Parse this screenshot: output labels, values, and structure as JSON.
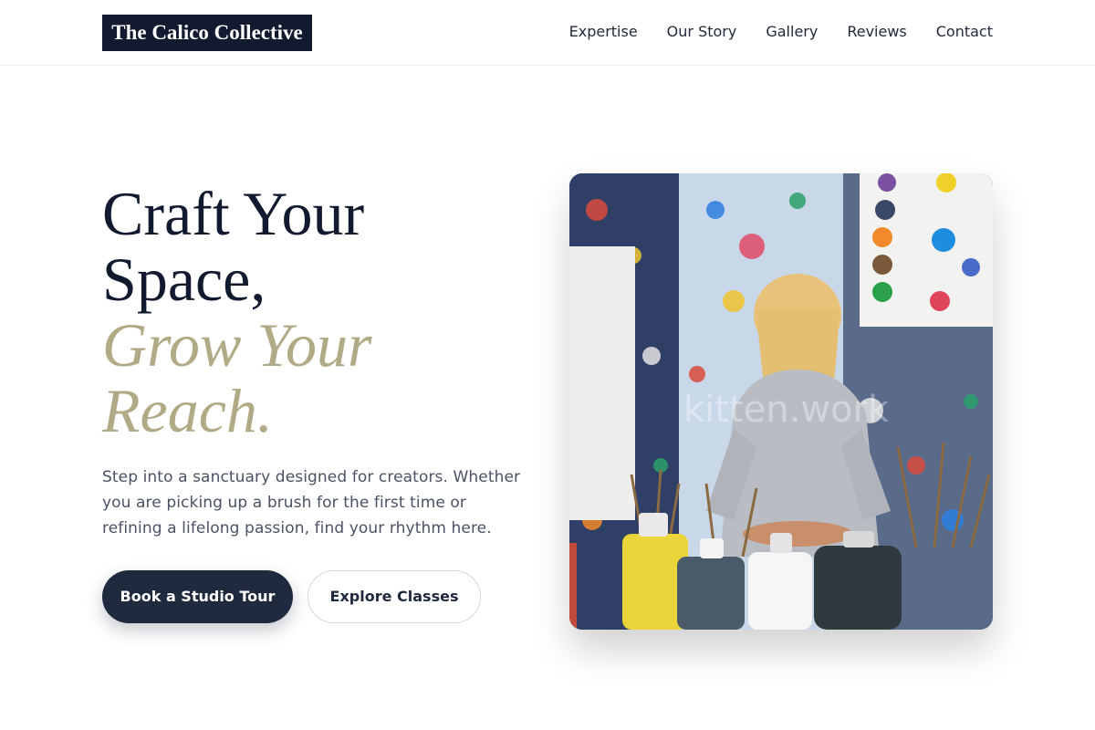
{
  "brand": {
    "name": "The Calico Collective"
  },
  "nav": {
    "items": [
      {
        "label": "Expertise"
      },
      {
        "label": "Our Story"
      },
      {
        "label": "Gallery"
      },
      {
        "label": "Reviews"
      },
      {
        "label": "Contact"
      }
    ]
  },
  "hero": {
    "headline": {
      "line1": "Craft Your",
      "line2": "Space,",
      "accent_line1": "Grow Your",
      "accent_line2": "Reach."
    },
    "lead": "Step into a sanctuary designed for creators. Whether you are picking up a brush for the first time or refining a lifelong passion, find your rhythm here.",
    "primary_cta": "Book a Studio Tour",
    "secondary_cta": "Explore Classes",
    "image": {
      "subject": "girl-in-paint-splattered-art-studio",
      "watermark": "kitten.work"
    }
  },
  "colors": {
    "navy": "#111a2e",
    "button": "#1f2a3e",
    "accent": "#b1aa87",
    "body_text": "#4a5264"
  }
}
